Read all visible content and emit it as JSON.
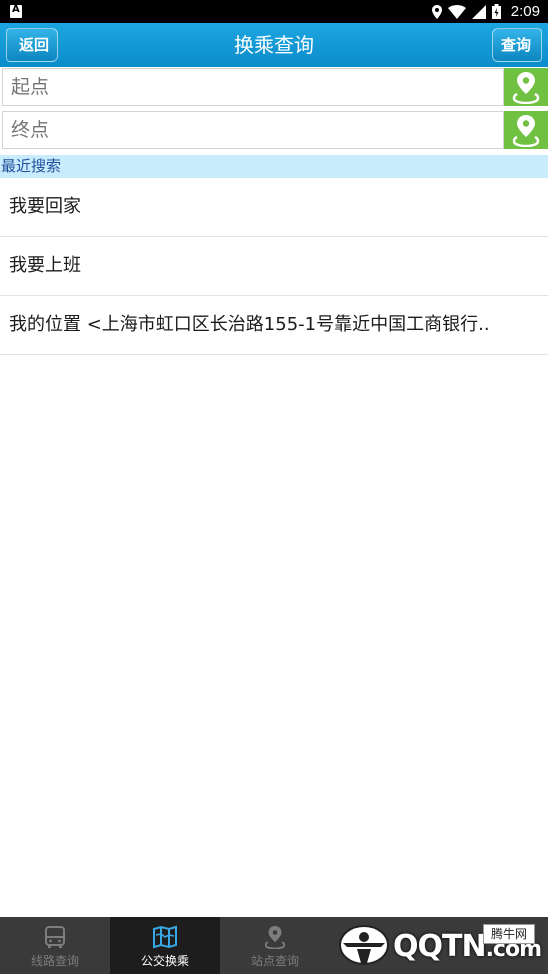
{
  "status_bar": {
    "time": "2:09",
    "left_icon": "notification-a-icon",
    "right_icons": [
      "location-icon",
      "wifi-icon",
      "signal-icon",
      "battery-icon"
    ]
  },
  "header": {
    "title": "换乘查询",
    "back_label": "返回",
    "query_label": "查询",
    "color": "#0e98d6"
  },
  "inputs": {
    "start_placeholder": "起点",
    "end_placeholder": "终点",
    "locate_icon": "location-pin-icon",
    "locate_color": "#70c042"
  },
  "recent": {
    "header": "最近搜索",
    "items": [
      "我要回家",
      "我要上班",
      "我的位置 <上海市虹口区长治路155-1号靠近中国工商银行.."
    ]
  },
  "bottom_nav": {
    "tabs": [
      {
        "label": "线路查询",
        "icon": "bus-icon",
        "active": false
      },
      {
        "label": "公交换乘",
        "icon": "map-icon",
        "active": true
      },
      {
        "label": "站点查询",
        "icon": "location-pin-icon",
        "active": false
      }
    ]
  },
  "watermark": {
    "text": "QQTN",
    "suffix": ".com",
    "badge": "腾牛网"
  }
}
